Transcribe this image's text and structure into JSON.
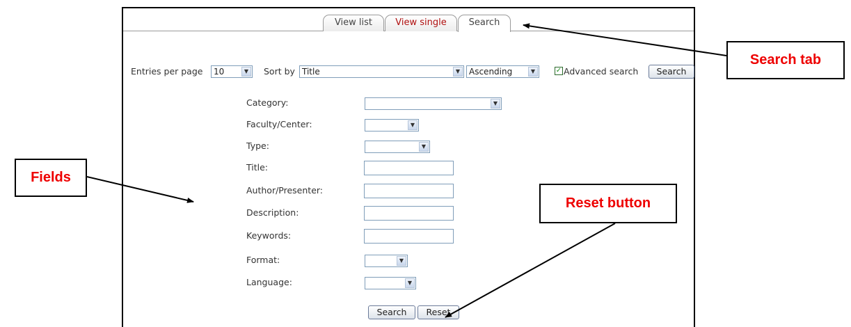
{
  "tabs": [
    {
      "label": "View list"
    },
    {
      "label": "View single"
    },
    {
      "label": "Search"
    }
  ],
  "toolbar": {
    "entries_label": "Entries per page",
    "entries_value": "10",
    "sort_label": "Sort by",
    "sort_value": "Title",
    "order_value": "Ascending",
    "advanced_label": "Advanced search",
    "advanced_checked": true,
    "search_button": "Search"
  },
  "fields": [
    {
      "label": "Category:",
      "type": "select",
      "value": ""
    },
    {
      "label": "Faculty/Center:",
      "type": "select",
      "value": ""
    },
    {
      "label": "Type:",
      "type": "select",
      "value": ""
    },
    {
      "label": "Title:",
      "type": "text",
      "value": ""
    },
    {
      "label": "Author/Presenter:",
      "type": "text",
      "value": ""
    },
    {
      "label": "Description:",
      "type": "text",
      "value": ""
    },
    {
      "label": "Keywords:",
      "type": "text",
      "value": ""
    },
    {
      "label": "Format:",
      "type": "select",
      "value": ""
    },
    {
      "label": "Language:",
      "type": "select",
      "value": ""
    }
  ],
  "form_buttons": {
    "search": "Search",
    "reset": "Reset"
  },
  "callouts": {
    "search_tab": "Search tab",
    "fields": "Fields",
    "reset_button": "Reset button"
  },
  "colors": {
    "callout_text": "#ee0000",
    "tab_active_text": "#b01010"
  }
}
